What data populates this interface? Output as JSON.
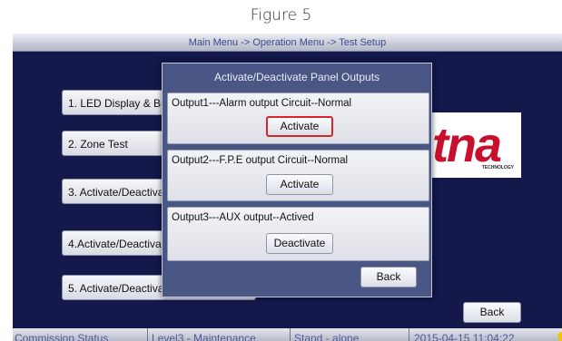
{
  "top_caption": "Figure 5",
  "titlebar": {
    "breadcrumb": "Main Menu -> Operation Menu -> Test Setup"
  },
  "menu": {
    "items": [
      {
        "label": "1. LED Display & Buzzer Test"
      },
      {
        "label": "2. Zone Test"
      },
      {
        "label": "3. Activate/Deactivate Zone"
      },
      {
        "label": "4.Activate/Deactivate Panel Outputs"
      },
      {
        "label": "5. Activate/Deactivate Relay Outputs"
      }
    ],
    "back_label": "Back"
  },
  "logo": {
    "text": "tna",
    "subtext": "TECHNOLOGY",
    "color": "#c8102e"
  },
  "dialog": {
    "title": "Activate/Deactivate Panel Outputs",
    "outputs": [
      {
        "label": "Output1---Alarm output Circuit--Normal",
        "button": "Activate",
        "focused": true
      },
      {
        "label": "Output2---F.P.E output Circuit--Normal",
        "button": "Activate",
        "focused": false
      },
      {
        "label": "Output3---AUX output--Actived",
        "button": "Deactivate",
        "focused": false
      }
    ],
    "back_label": "Back"
  },
  "statusbar": {
    "commission": "Commission Status",
    "level": "Level3 - Maintenance",
    "mode": "Stand - alone",
    "datetime": "2015-04-15 11:04:22"
  },
  "colors": {
    "screen_bg": "#14184a",
    "dialog_bg": "#4a5784",
    "focus_border": "#d6262b",
    "status_dot": "#f5c400"
  }
}
